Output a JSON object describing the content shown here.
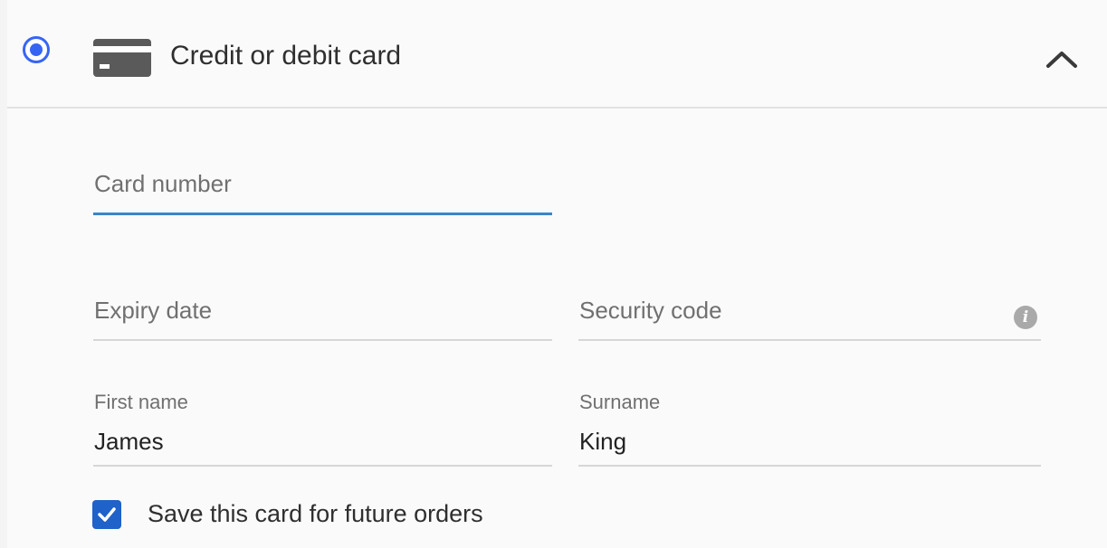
{
  "payment_option": {
    "title": "Credit or debit card",
    "selected": true,
    "expanded": true,
    "icon": "credit-card-icon",
    "collapse_icon": "chevron-up-icon"
  },
  "form": {
    "card_number": {
      "placeholder": "Card number",
      "value": ""
    },
    "expiry_date": {
      "placeholder": "Expiry date",
      "value": ""
    },
    "security_code": {
      "placeholder": "Security code",
      "value": "",
      "help_icon": "info-icon",
      "help_glyph": "i"
    },
    "first_name": {
      "label": "First name",
      "value": "James"
    },
    "surname": {
      "label": "Surname",
      "value": "King"
    },
    "save_card": {
      "label": "Save this card for future orders",
      "checked": true
    }
  },
  "colors": {
    "accent": "#3665f3",
    "focus_underline": "#3a84c9",
    "checkbox": "#1f62c9"
  }
}
